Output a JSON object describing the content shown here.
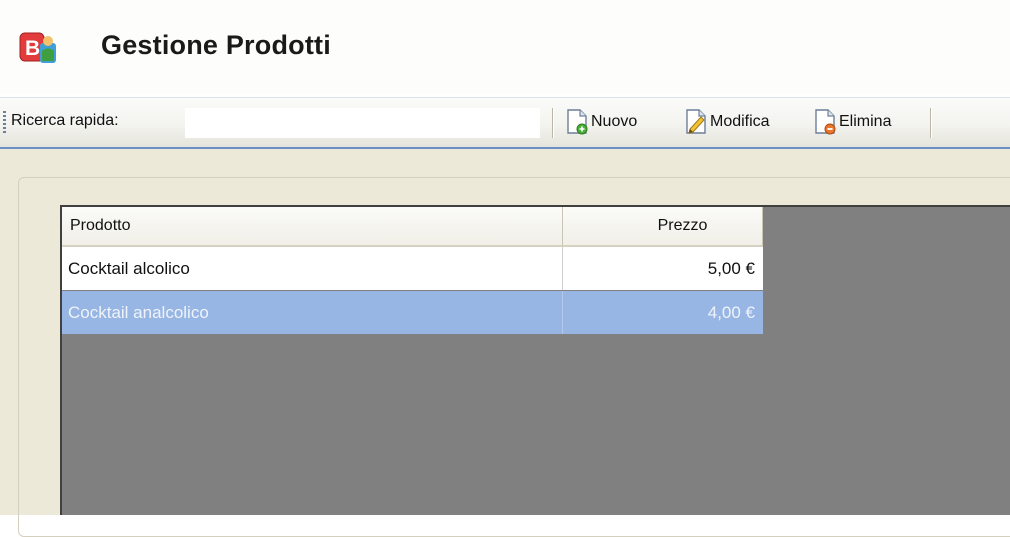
{
  "window": {
    "title": "Gestione Prodotti",
    "app_icon": "app-logo-icon"
  },
  "toolbar": {
    "search_label": "Ricerca rapida:",
    "search_value": "",
    "buttons": {
      "nuovo": {
        "label": "Nuovo",
        "icon": "new-document-icon"
      },
      "modifica": {
        "label": "Modifica",
        "icon": "edit-pencil-icon"
      },
      "elimina": {
        "label": "Elimina",
        "icon": "delete-document-icon"
      }
    }
  },
  "table": {
    "columns": [
      "Prodotto",
      "Prezzo"
    ],
    "rows": [
      {
        "prodotto": "Cocktail alcolico",
        "prezzo": "5,00 €",
        "selected": false
      },
      {
        "prodotto": "Cocktail analcolico",
        "prezzo": "4,00 €",
        "selected": true
      }
    ]
  },
  "colors": {
    "selection": "#98b6e4",
    "toolbar_border": "#6a8fc7",
    "grid_background": "#808080",
    "panel_background": "#ece9d8"
  }
}
